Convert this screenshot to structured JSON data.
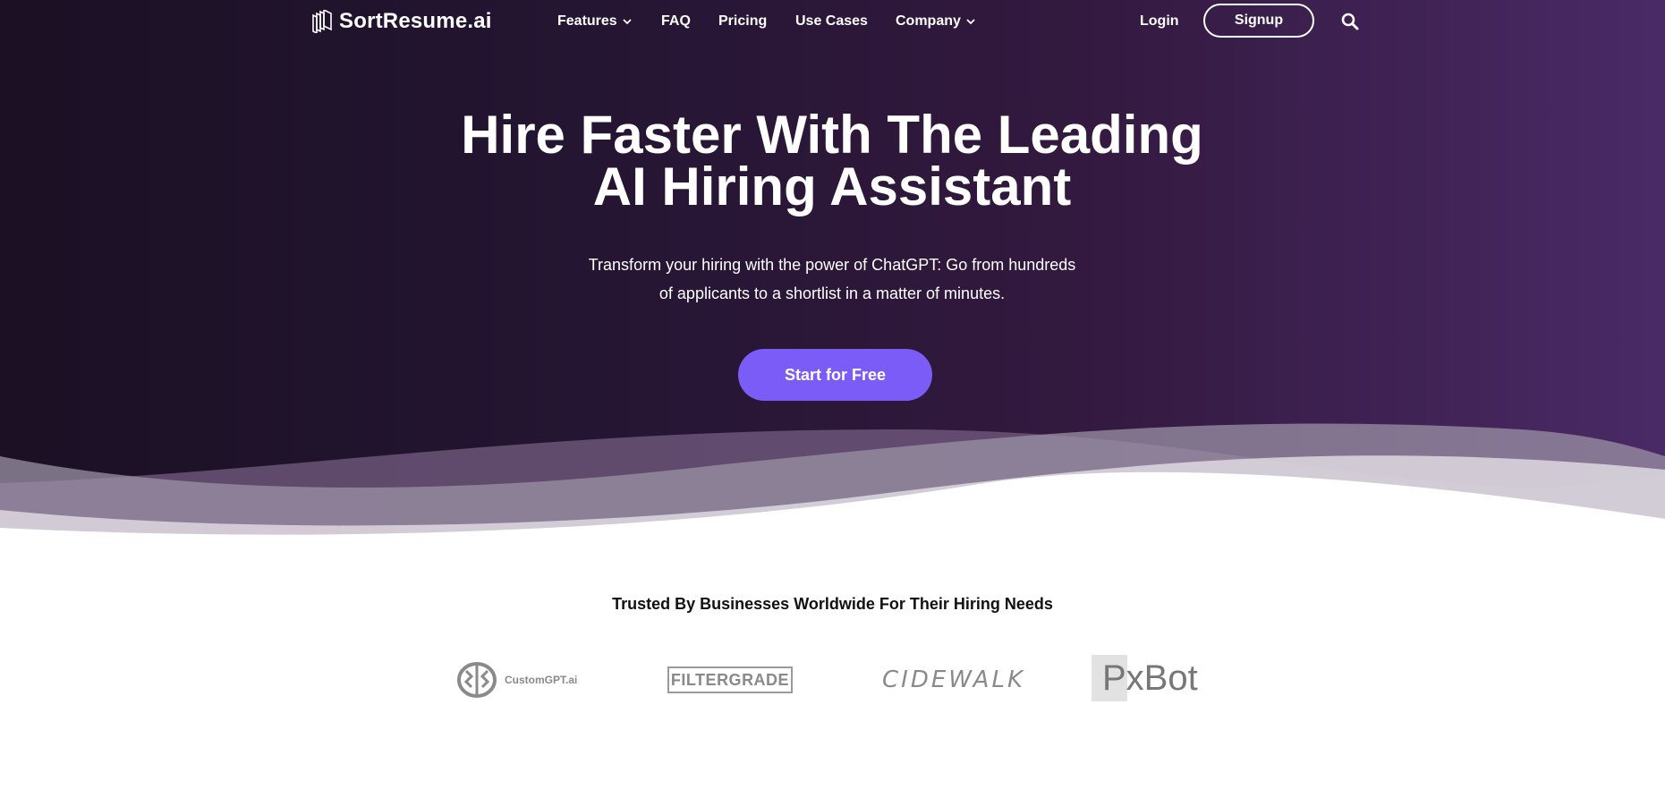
{
  "nav": {
    "logo_text": "SortResume.ai",
    "items": [
      {
        "label": "Features",
        "has_dropdown": true
      },
      {
        "label": "FAQ",
        "has_dropdown": false
      },
      {
        "label": "Pricing",
        "has_dropdown": false
      },
      {
        "label": "Use Cases",
        "has_dropdown": false
      },
      {
        "label": "Company",
        "has_dropdown": true
      }
    ],
    "login_label": "Login",
    "signup_label": "Signup",
    "search_icon": "search-icon"
  },
  "hero": {
    "headline_line1": "Hire Faster With The Leading",
    "headline_line2": "AI Hiring Assistant",
    "subtext_line1": "Transform your hiring with the power of ChatGPT: Go from hundreds",
    "subtext_line2": "of applicants to a shortlist in a matter of minutes.",
    "cta_label": "Start for Free"
  },
  "trusted": {
    "title": "Trusted By Businesses Worldwide For Their Hiring Needs",
    "logos": [
      {
        "name": "CustomGPT.ai",
        "icon": "brain-icon"
      },
      {
        "name": "FILTERGRADE"
      },
      {
        "name": "CIDEWALK"
      },
      {
        "name": "PxBot"
      }
    ]
  },
  "colors": {
    "hero_dark": "#1b1024",
    "hero_purple": "#4a2a66",
    "cta": "#7b5cf6",
    "text_light": "#ffffff"
  }
}
